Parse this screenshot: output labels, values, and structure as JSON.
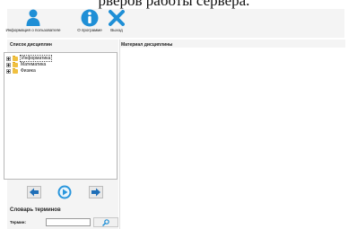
{
  "caption": "рверов работы сервера.",
  "toolbar": {
    "user_info_label": "Информация о пользователе",
    "about_label": "О программе",
    "exit_label": "Выход"
  },
  "left_panel": {
    "title": "Список дисциплин",
    "tree_items": [
      "Информатика",
      "Математика",
      "Физика"
    ]
  },
  "right_panel": {
    "title": "Материал дисциплины"
  },
  "glossary": {
    "title": "Словарь терминов",
    "term_label": "Термин:",
    "term_value": ""
  },
  "icons": {
    "user": "user-icon",
    "about": "info-icon",
    "exit": "close-icon",
    "prev": "arrow-left-icon",
    "play": "play-circle-icon",
    "next": "arrow-right-icon",
    "search": "magnifier-icon"
  },
  "colors": {
    "accent": "#1f8fd6",
    "panel_bg": "#f4f4f4",
    "folder": "#f0c040"
  }
}
